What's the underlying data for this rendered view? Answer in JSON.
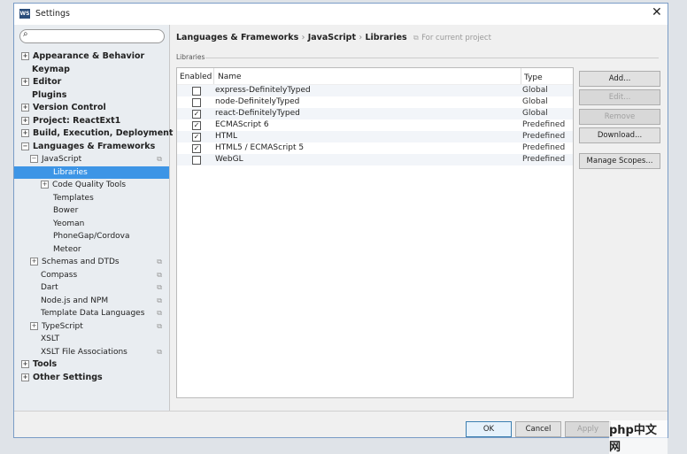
{
  "window": {
    "title": "Settings",
    "app_icon": "WS"
  },
  "sidebar": {
    "items": [
      {
        "label": "Appearance & Behavior",
        "level": 0,
        "bold": true,
        "expander": "+"
      },
      {
        "label": "Keymap",
        "level": 0,
        "bold": true,
        "expander": ""
      },
      {
        "label": "Editor",
        "level": 0,
        "bold": true,
        "expander": "+"
      },
      {
        "label": "Plugins",
        "level": 0,
        "bold": true,
        "expander": ""
      },
      {
        "label": "Version Control",
        "level": 0,
        "bold": true,
        "expander": "+"
      },
      {
        "label": "Project: ReactExt1",
        "level": 0,
        "bold": true,
        "expander": "+"
      },
      {
        "label": "Build, Execution, Deployment",
        "level": 0,
        "bold": true,
        "expander": "+"
      },
      {
        "label": "Languages & Frameworks",
        "level": 0,
        "bold": true,
        "expander": "−"
      },
      {
        "label": "JavaScript",
        "level": 1,
        "expander": "−",
        "copy": true
      },
      {
        "label": "Libraries",
        "level": 2,
        "expander": "",
        "selected": true
      },
      {
        "label": "Code Quality Tools",
        "level": 2,
        "expander": "+"
      },
      {
        "label": "Templates",
        "level": 2,
        "expander": ""
      },
      {
        "label": "Bower",
        "level": 2,
        "expander": ""
      },
      {
        "label": "Yeoman",
        "level": 2,
        "expander": ""
      },
      {
        "label": "PhoneGap/Cordova",
        "level": 2,
        "expander": ""
      },
      {
        "label": "Meteor",
        "level": 2,
        "expander": ""
      },
      {
        "label": "Schemas and DTDs",
        "level": 1,
        "expander": "+",
        "copy": true
      },
      {
        "label": "Compass",
        "level": 1,
        "expander": "",
        "copy": true
      },
      {
        "label": "Dart",
        "level": 1,
        "expander": "",
        "copy": true
      },
      {
        "label": "Node.js and NPM",
        "level": 1,
        "expander": "",
        "copy": true
      },
      {
        "label": "Template Data Languages",
        "level": 1,
        "expander": "",
        "copy": true
      },
      {
        "label": "TypeScript",
        "level": 1,
        "expander": "+",
        "copy": true
      },
      {
        "label": "XSLT",
        "level": 1,
        "expander": ""
      },
      {
        "label": "XSLT File Associations",
        "level": 1,
        "expander": "",
        "copy": true
      },
      {
        "label": "Tools",
        "level": 0,
        "bold": true,
        "expander": "+"
      },
      {
        "label": "Other Settings",
        "level": 0,
        "bold": true,
        "expander": "+"
      }
    ]
  },
  "breadcrumb": {
    "parts": [
      "Languages & Frameworks",
      "JavaScript",
      "Libraries"
    ],
    "sep": "›",
    "scope": "For current project"
  },
  "libraries": {
    "group_label": "Libraries",
    "columns": [
      "Enabled",
      "Name",
      "Type"
    ],
    "rows": [
      {
        "enabled": false,
        "name": "express-DefinitelyTyped",
        "type": "Global"
      },
      {
        "enabled": false,
        "name": "node-DefinitelyTyped",
        "type": "Global"
      },
      {
        "enabled": true,
        "name": "react-DefinitelyTyped",
        "type": "Global"
      },
      {
        "enabled": true,
        "name": "ECMAScript 6",
        "type": "Predefined"
      },
      {
        "enabled": true,
        "name": "HTML",
        "type": "Predefined"
      },
      {
        "enabled": true,
        "name": "HTML5 / ECMAScript 5",
        "type": "Predefined"
      },
      {
        "enabled": false,
        "name": "WebGL",
        "type": "Predefined"
      }
    ]
  },
  "buttons": {
    "add": "Add...",
    "edit": "Edit...",
    "remove": "Remove",
    "download": "Download...",
    "manage_scopes": "Manage Scopes..."
  },
  "footer": {
    "ok": "OK",
    "cancel": "Cancel",
    "apply": "Apply"
  },
  "watermark": "php中文网"
}
